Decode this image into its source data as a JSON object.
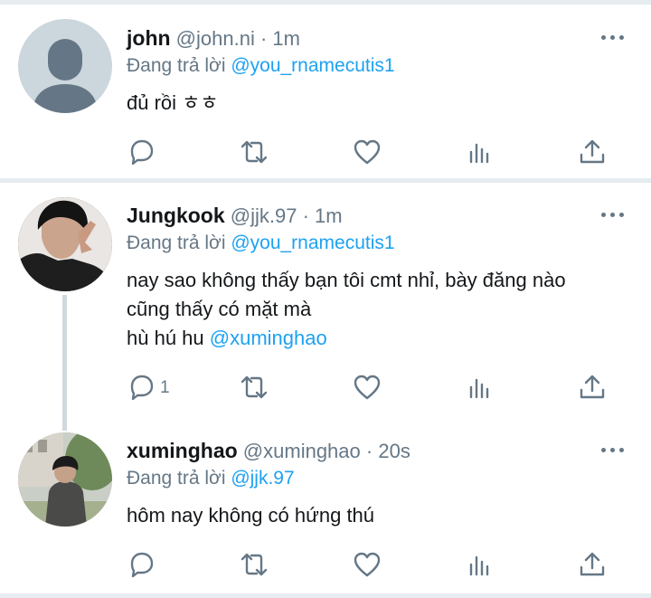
{
  "tweets": [
    {
      "name": "john",
      "handle": "@john.ni",
      "time": "1m",
      "reply_prefix": "Đang trả lời",
      "reply_to": "@you_rnamecutis1",
      "text_lines": [
        "đủ rồi ㅎㅎ"
      ],
      "reply_count": ""
    },
    {
      "name": "Jungkook",
      "handle": "@jjk.97",
      "time": "1m",
      "reply_prefix": "Đang trả lời",
      "reply_to": "@you_rnamecutis1",
      "text_lines": [
        "nay sao không thấy bạn tôi cmt nhỉ, bày đăng nào",
        "cũng thấy có mặt mà"
      ],
      "text_line3_prefix": "hù hú hu ",
      "text_line3_mention": "@xuminghao",
      "reply_count": "1"
    },
    {
      "name": "xuminghao",
      "handle": "@xuminghao",
      "time": "20s",
      "reply_prefix": "Đang trả lời",
      "reply_to": "@jjk.97",
      "text_lines": [
        "hôm nay không có hứng thú"
      ],
      "reply_count": ""
    }
  ],
  "separator": "·",
  "icons": [
    "reply-icon",
    "retweet-icon",
    "like-icon",
    "analytics-icon",
    "share-icon",
    "more-icon"
  ],
  "colors": {
    "link": "#1da1f2",
    "muted": "#657786",
    "divider": "#e6ecf0"
  }
}
